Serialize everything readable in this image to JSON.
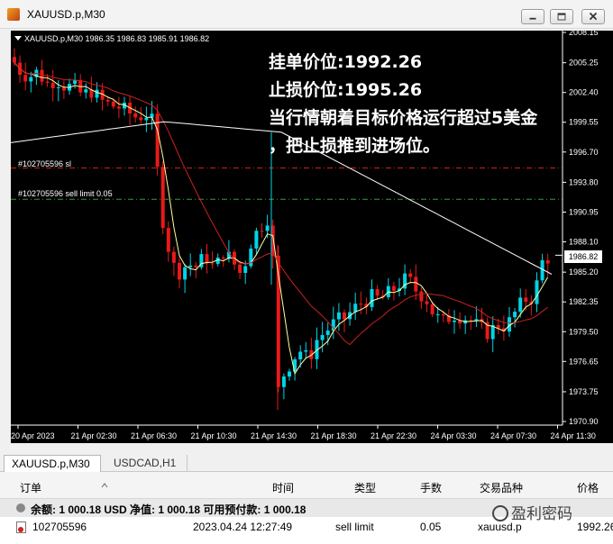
{
  "window": {
    "title": "XAUUSD.p,M30"
  },
  "chart": {
    "header": "XAUUSD.p,M30  1986.35 1986.83 1985.91 1986.82",
    "last_price": "1986.82",
    "price_ticks": [
      "2008.15",
      "2005.25",
      "2002.40",
      "1999.55",
      "1996.70",
      "1993.80",
      "1990.95",
      "1988.10",
      "1985.20",
      "1982.35",
      "1979.50",
      "1976.65",
      "1973.75",
      "1970.90"
    ],
    "time_ticks": [
      "20 Apr 2023",
      "21 Apr 02:30",
      "21 Apr 06:30",
      "21 Apr 10:30",
      "21 Apr 14:30",
      "21 Apr 18:30",
      "21 Apr 22:30",
      "24 Apr 03:30",
      "24 Apr 07:30",
      "24 Apr 11:30"
    ],
    "sl_label": "#102705596 sl",
    "order_label": "#102705596 sell limit 0.05",
    "colors": {
      "bull": "#00d4e8",
      "bear": "#e81a1a",
      "ma_fast": "#ffffa0",
      "ma_slow": "#cc2020",
      "ma_long": "#ffffff"
    }
  },
  "overlay": {
    "line1": "挂单价位:1992.26",
    "line2": "止损价位:1995.26",
    "line3": "当行情朝着目标价格运行超过5美金",
    "line4": "，把止损推到进场位。"
  },
  "tabs": [
    {
      "label": "XAUUSD.p,M30"
    },
    {
      "label": "USDCAD,H1"
    }
  ],
  "table": {
    "headers": [
      "订单",
      "时间",
      "类型",
      "手数",
      "交易品种",
      "价格"
    ],
    "summary": "余额: 1 000.18 USD  净值: 1 000.18  可用预付款: 1 000.18",
    "row": {
      "order": "102705596",
      "time": "2023.04.24 12:27:49",
      "type": "sell limit",
      "lots": "0.05",
      "symbol": "xauusd.p",
      "price": "1992.26"
    }
  },
  "watermark": "盈利密码"
}
